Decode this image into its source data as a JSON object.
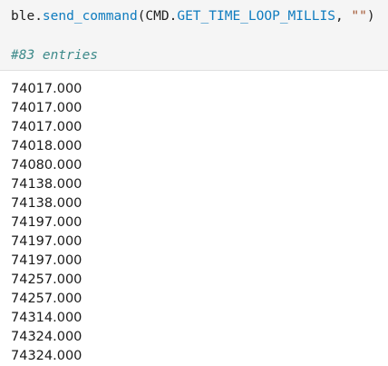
{
  "input_cell": {
    "code_parts": {
      "p1": "ble.",
      "p2": "send_command",
      "p3": "(CMD.",
      "p4": "GET_TIME_LOOP_MILLIS",
      "p5": ", ",
      "p6": "\"\"",
      "p7": ")"
    },
    "comment": "#83 entries"
  },
  "output_cell": {
    "values": [
      "74017.000",
      "74017.000",
      "74017.000",
      "74018.000",
      "74080.000",
      "74138.000",
      "74138.000",
      "74197.000",
      "74197.000",
      "74197.000",
      "74257.000",
      "74257.000",
      "74314.000",
      "74324.000",
      "74324.000"
    ]
  },
  "colors": {
    "attribute": "#0f7cbf",
    "string": "#a0522d",
    "comment": "#3d8a8a",
    "input_background": "#f5f5f5"
  }
}
